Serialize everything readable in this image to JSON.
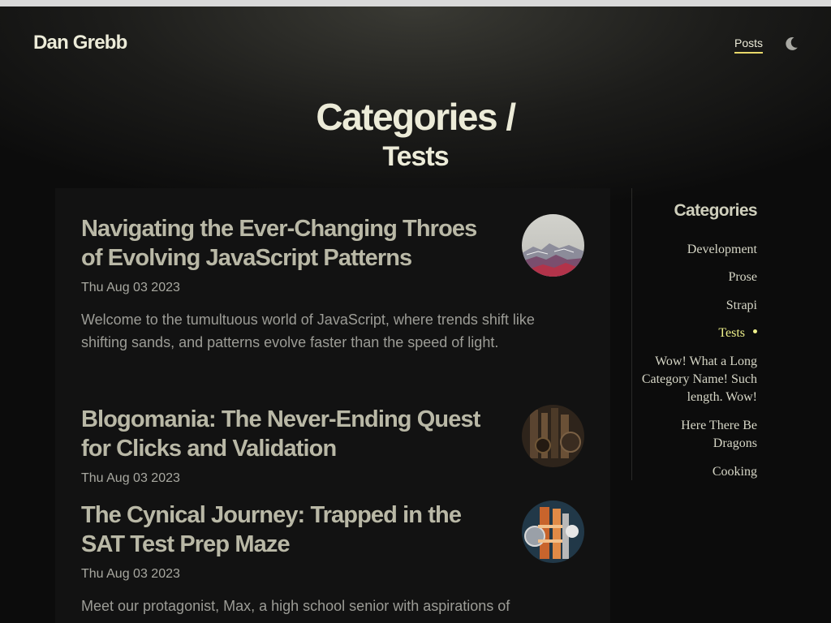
{
  "header": {
    "brand": "Dan Grebb",
    "nav": {
      "posts_label": "Posts"
    },
    "theme_toggle_icon": "moon-icon"
  },
  "page": {
    "title_line1": "Categories /",
    "title_line2": "Tests"
  },
  "posts": [
    {
      "title": "Navigating the Ever-Changing Throes of Evolving JavaScript Patterns",
      "date": "Thu Aug 03 2023",
      "excerpt": "Welcome to the tumultuous world of JavaScript, where trends shift like shifting sands, and patterns evolve faster than the speed of light.",
      "thumbnail_icon": "mountain-thumbnail"
    },
    {
      "title": "Blogomania: The Never-Ending Quest for Clicks and Validation",
      "date": "Thu Aug 03 2023",
      "excerpt": "",
      "thumbnail_icon": "bronze-sculpture-thumbnail"
    },
    {
      "title": "The Cynical Journey: Trapped in the SAT Test Prep Maze",
      "date": "Thu Aug 03 2023",
      "excerpt": "Meet our protagonist, Max, a high school senior with aspirations of",
      "thumbnail_icon": "machinery-thumbnail"
    }
  ],
  "sidebar": {
    "heading": "Categories",
    "items": [
      {
        "label": "Development"
      },
      {
        "label": "Prose"
      },
      {
        "label": "Strapi"
      },
      {
        "label": "Tests",
        "active": true
      },
      {
        "label": "Wow! What a Long Category Name! Such length. Wow!"
      },
      {
        "label": "Here There Be Dragons"
      },
      {
        "label": "Cooking"
      }
    ]
  },
  "colors": {
    "accent": "#eef08a",
    "nav_underline": "#e8d86a",
    "post_title": "#b9b8a6",
    "panel_bg": "#121212"
  }
}
